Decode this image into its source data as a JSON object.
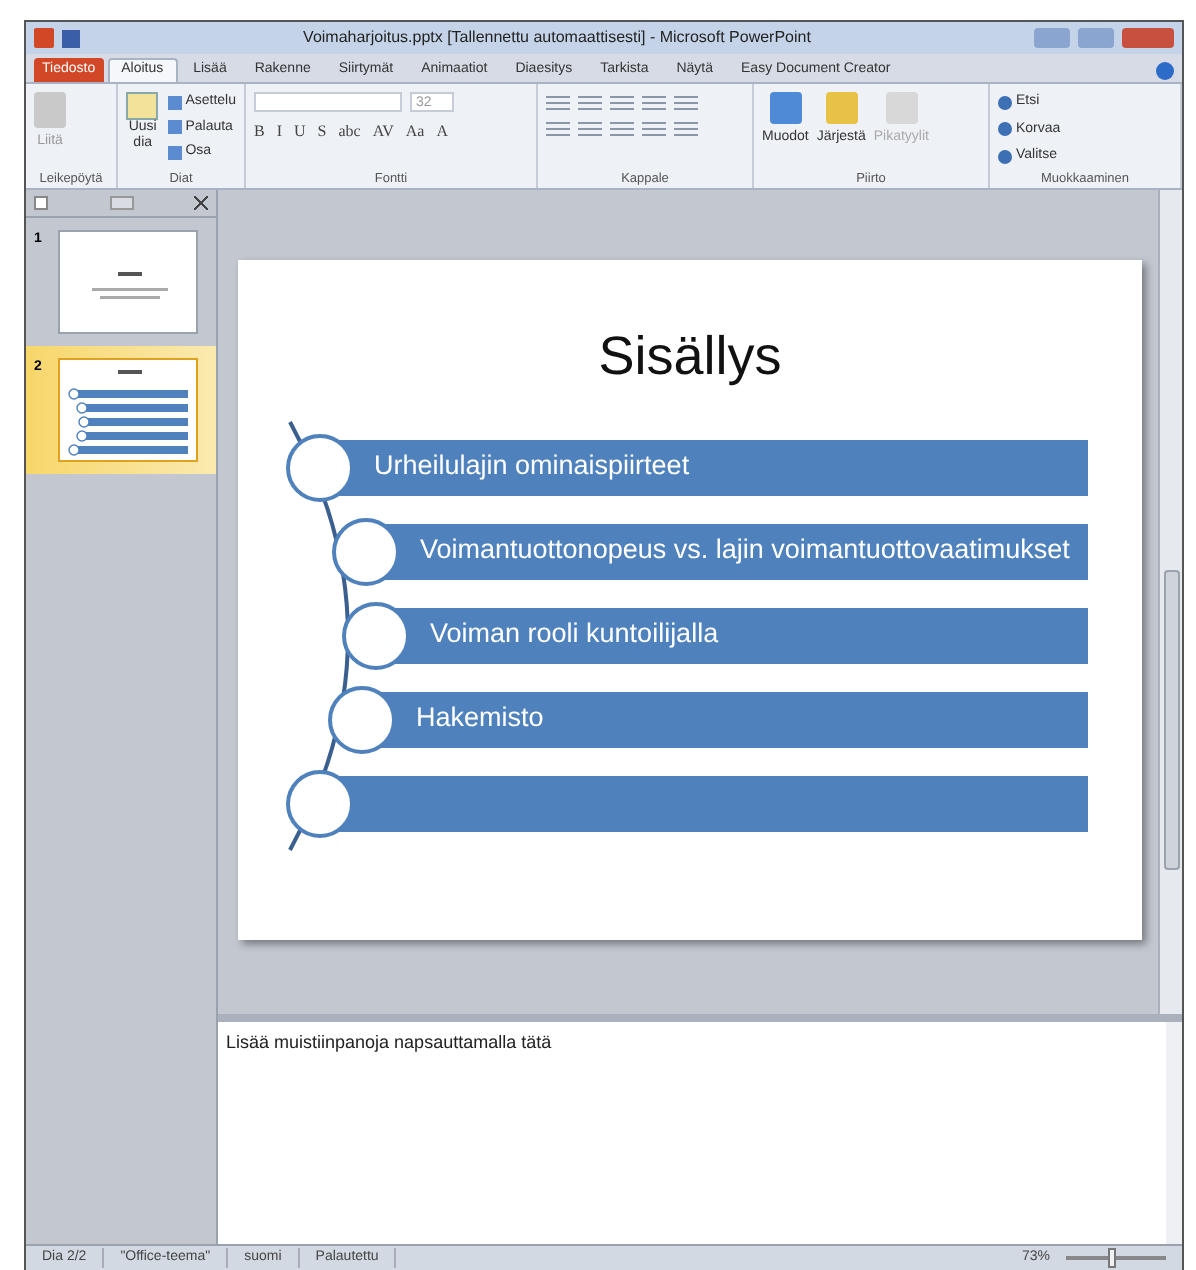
{
  "window": {
    "title": "Voimaharjoitus.pptx [Tallennettu automaattisesti] - Microsoft PowerPoint"
  },
  "ribbon_tabs": [
    {
      "label": "Tiedosto",
      "kind": "file",
      "selected": false
    },
    {
      "label": "Aloitus",
      "kind": "tab",
      "selected": true
    },
    {
      "label": "Lisää",
      "kind": "tab",
      "selected": false
    },
    {
      "label": "Rakenne",
      "kind": "tab",
      "selected": false
    },
    {
      "label": "Siirtymät",
      "kind": "tab",
      "selected": false
    },
    {
      "label": "Animaatiot",
      "kind": "tab",
      "selected": false
    },
    {
      "label": "Diaesitys",
      "kind": "tab",
      "selected": false
    },
    {
      "label": "Tarkista",
      "kind": "tab",
      "selected": false
    },
    {
      "label": "Näytä",
      "kind": "tab",
      "selected": false
    },
    {
      "label": "Easy Document Creator",
      "kind": "tab",
      "selected": false
    }
  ],
  "ribbon": {
    "clipboard": {
      "label": "Leikepöytä",
      "paste": "Liitä"
    },
    "slides": {
      "label": "Diat",
      "new_slide": "Uusi dia",
      "layout": "Asettelu",
      "reset": "Palauta",
      "section": "Osa"
    },
    "font": {
      "label": "Fontti",
      "size": "32",
      "buttons": [
        "B",
        "I",
        "U",
        "S",
        "abc",
        "AV",
        "Aa",
        "A"
      ]
    },
    "paragraph": {
      "label": "Kappale"
    },
    "drawing": {
      "label": "Piirto",
      "buttons": [
        "Muodot",
        "Järjestä",
        "Pikatyylit"
      ]
    },
    "editing": {
      "label": "Muokkaaminen",
      "buttons": [
        "Etsi",
        "Korvaa",
        "Valitse"
      ]
    }
  },
  "thumbnails": [
    {
      "number": "1",
      "kind": "title",
      "selected": false
    },
    {
      "number": "2",
      "kind": "list",
      "selected": true
    }
  ],
  "slide": {
    "title": "Sisällys",
    "items": [
      {
        "kind": "text",
        "text": "Urheilulajin ominaispiirteet"
      },
      {
        "kind": "text",
        "text": "Voimantuottonopeus vs. lajin voimantuottovaatimukset"
      },
      {
        "kind": "text",
        "text": "Voiman rooli kuntoilijalla"
      },
      {
        "kind": "text",
        "text": "Hakemisto"
      },
      {
        "kind": "empty"
      }
    ]
  },
  "notes": {
    "placeholder": "Lisää muistiinpanoja napsauttamalla tätä"
  },
  "status_bar": {
    "items": [
      "Dia 2/2",
      "\"Office-teema\"",
      "suomi",
      "Palautettu"
    ],
    "zoom": "73%",
    "zoom_slider": {
      "level": 0.45
    }
  }
}
